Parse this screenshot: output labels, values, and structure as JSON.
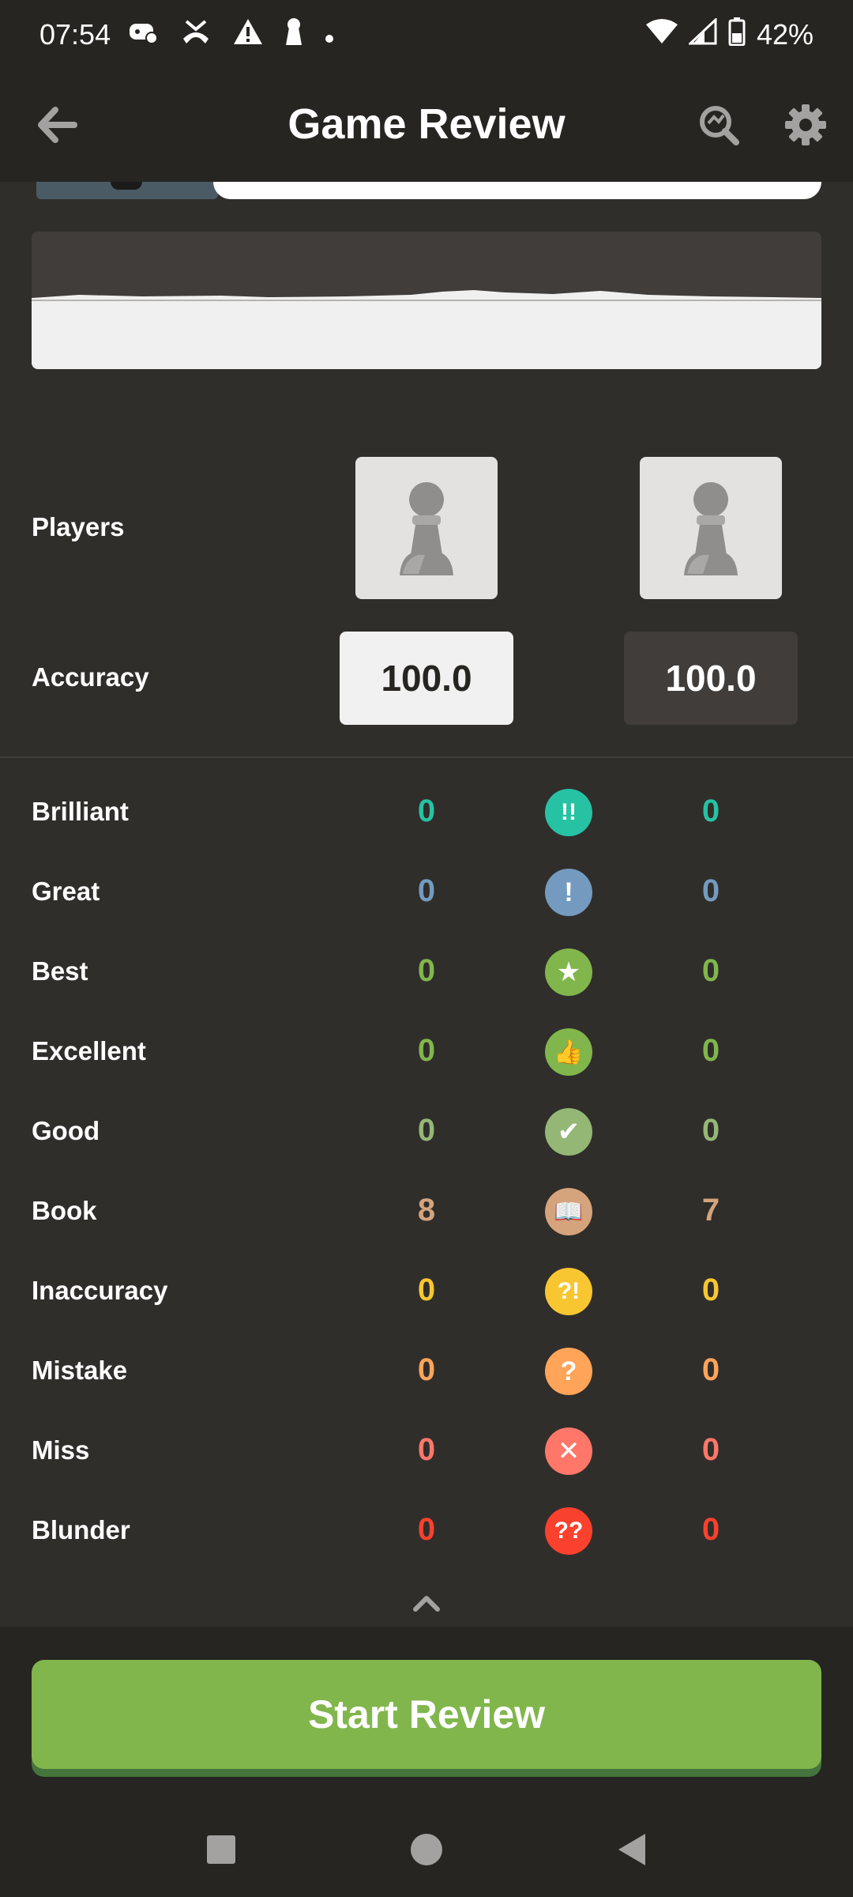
{
  "status_bar": {
    "time": "07:54",
    "battery": "42%",
    "icons": [
      "game-controller-icon",
      "missed-call-icon",
      "warning-icon",
      "keyhole-icon",
      "dot-icon",
      "wifi-icon",
      "signal-icon",
      "battery-icon"
    ]
  },
  "app_bar": {
    "title": "Game Review",
    "back_icon": "arrow-left-icon",
    "analysis_icon": "magnifier-analysis-icon",
    "settings_icon": "gear-icon"
  },
  "players": {
    "label": "Players",
    "white_avatar": "pawn-avatar-icon",
    "black_avatar": "pawn-avatar-icon"
  },
  "accuracy": {
    "label": "Accuracy",
    "white": "100.0",
    "black": "100.0"
  },
  "classifications": [
    {
      "label": "Brilliant",
      "white": "0",
      "black": "0",
      "symbol": "!!",
      "color": "#26c2a3",
      "icon": "brilliant-icon"
    },
    {
      "label": "Great",
      "white": "0",
      "black": "0",
      "symbol": "!",
      "color": "#749bbf",
      "icon": "great-icon"
    },
    {
      "label": "Best",
      "white": "0",
      "black": "0",
      "symbol": "★",
      "color": "#81b64c",
      "icon": "star-icon"
    },
    {
      "label": "Excellent",
      "white": "0",
      "black": "0",
      "symbol": "👍",
      "color": "#81b64c",
      "icon": "thumbs-up-icon"
    },
    {
      "label": "Good",
      "white": "0",
      "black": "0",
      "symbol": "✔",
      "color": "#95b776",
      "icon": "check-icon"
    },
    {
      "label": "Book",
      "white": "8",
      "black": "7",
      "symbol": "📖",
      "color": "#d5a47d",
      "icon": "book-icon"
    },
    {
      "label": "Inaccuracy",
      "white": "0",
      "black": "0",
      "symbol": "?!",
      "color": "#f7c631",
      "icon": "inaccuracy-icon"
    },
    {
      "label": "Mistake",
      "white": "0",
      "black": "0",
      "symbol": "?",
      "color": "#ffa459",
      "icon": "mistake-icon"
    },
    {
      "label": "Miss",
      "white": "0",
      "black": "0",
      "symbol": "✕",
      "color": "#ff7769",
      "icon": "miss-icon"
    },
    {
      "label": "Blunder",
      "white": "0",
      "black": "0",
      "symbol": "??",
      "color": "#fa412d",
      "icon": "blunder-icon"
    }
  ],
  "collapse_icon": "chevron-up-icon",
  "start_button": "Start Review",
  "nav": [
    "recents-square-icon",
    "home-circle-icon",
    "back-triangle-icon"
  ],
  "colors": {
    "background": "#302e2b",
    "bar": "#262522",
    "accent_green": "#81b64c"
  }
}
